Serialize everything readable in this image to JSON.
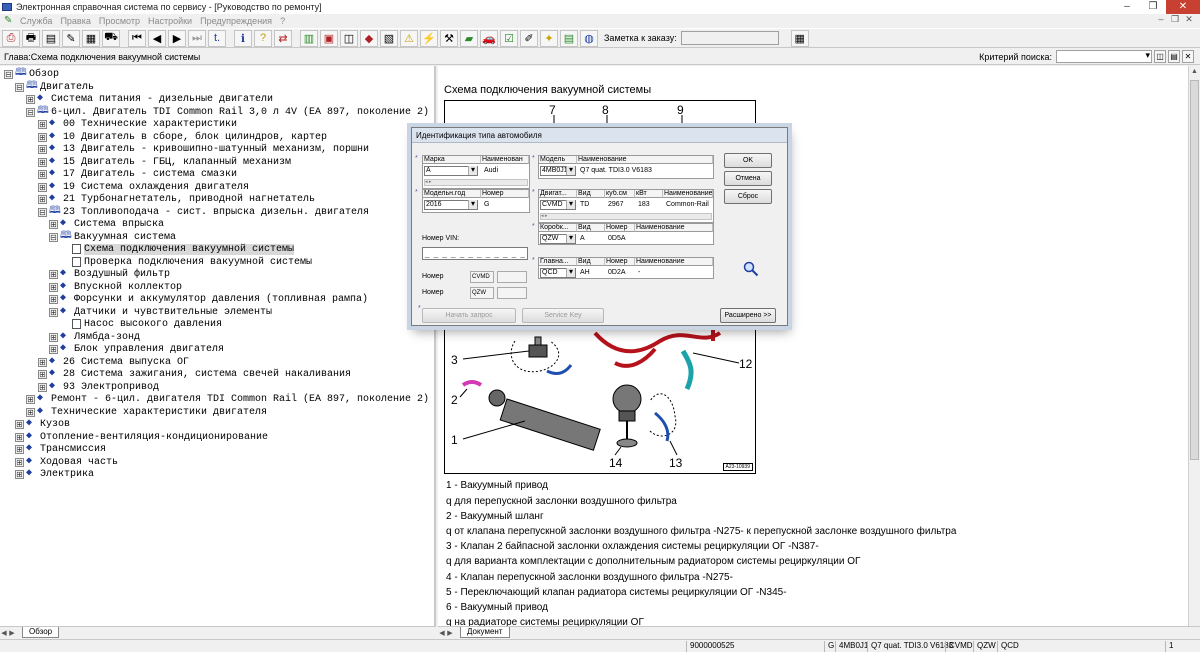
{
  "window": {
    "title": "Электронная справочная система по сервису - [Руководство по ремонту]",
    "controls": [
      "–",
      "❐",
      "✕"
    ]
  },
  "menu": {
    "items": [
      "Служба",
      "Правка",
      "Просмотр",
      "Настройки",
      "Предупреждения",
      "?"
    ],
    "right_controls": [
      "–",
      "❐",
      "✕"
    ]
  },
  "toolbar": {
    "order_note_label": "Заметка к заказу:",
    "order_note_value": ""
  },
  "chapter": {
    "label": "Глава:Схема подключения вакуумной системы",
    "search_criteria_label": "Критерий поиска:",
    "search_criteria_value": ""
  },
  "tree": [
    {
      "label": "Обзор",
      "expander": "⊟",
      "icon": "book-open-icon",
      "selected": false
    },
    {
      "label": "Двигатель",
      "expander": "⊟",
      "icon": "book-open-icon",
      "selected": false
    },
    {
      "label": "Система питания - дизельные двигатели",
      "expander": "⊞",
      "icon": "book-closed-icon",
      "selected": false
    },
    {
      "label": "6-цил. Двигатель TDI Common Rail 3,0 л 4V (EA 897, поколение 2)",
      "expander": "⊟",
      "icon": "book-open-icon",
      "selected": false
    },
    {
      "label": "00 Технические характеристики",
      "expander": "⊞",
      "icon": "book-closed-icon",
      "selected": false
    },
    {
      "label": "10 Двигатель в сборе, блок цилиндров, картер",
      "expander": "⊞",
      "icon": "book-closed-icon",
      "selected": false
    },
    {
      "label": "13 Двигатель - кривошипно-шатунный механизм, поршни",
      "expander": "⊞",
      "icon": "book-closed-icon",
      "selected": false
    },
    {
      "label": "15 Двигатель - ГБЦ, клапанный механизм",
      "expander": "⊞",
      "icon": "book-closed-icon",
      "selected": false
    },
    {
      "label": "17 Двигатель - система смазки",
      "expander": "⊞",
      "icon": "book-closed-icon",
      "selected": false
    },
    {
      "label": "19 Система охлаждения двигателя",
      "expander": "⊞",
      "icon": "book-closed-icon",
      "selected": false
    },
    {
      "label": "21 Турбонагнетатель, приводной нагнетатель",
      "expander": "⊞",
      "icon": "book-closed-icon",
      "selected": false
    },
    {
      "label": "23 Топливоподача - сист. впрыска дизельн. двигателя",
      "expander": "⊟",
      "icon": "book-open-icon",
      "selected": false
    },
    {
      "label": "Система впрыска",
      "expander": "⊞",
      "icon": "book-closed-icon",
      "selected": false
    },
    {
      "label": "Вакуумная система",
      "expander": "⊟",
      "icon": "book-open-icon",
      "selected": false
    },
    {
      "label": "Схема подключения вакуумной системы",
      "expander": "",
      "icon": "page-icon",
      "selected": true
    },
    {
      "label": "Проверка подключения вакуумной системы",
      "expander": "",
      "icon": "page-icon",
      "selected": false
    },
    {
      "label": "Воздушный фильтр",
      "expander": "⊞",
      "icon": "book-closed-icon",
      "selected": false
    },
    {
      "label": "Впускной коллектор",
      "expander": "⊞",
      "icon": "book-closed-icon",
      "selected": false
    },
    {
      "label": "Форсунки и аккумулятор давления (топливная рампа)",
      "expander": "⊞",
      "icon": "book-closed-icon",
      "selected": false
    },
    {
      "label": "Датчики и чувствительные элементы",
      "expander": "⊞",
      "icon": "book-closed-icon",
      "selected": false
    },
    {
      "label": "Насос высокого давления",
      "expander": "",
      "icon": "page-icon",
      "selected": false
    },
    {
      "label": "Лямбда-зонд",
      "expander": "⊞",
      "icon": "book-closed-icon",
      "selected": false
    },
    {
      "label": "Блок управления двигателя",
      "expander": "⊞",
      "icon": "book-closed-icon",
      "selected": false
    },
    {
      "label": "26 Система выпуска ОГ",
      "expander": "⊞",
      "icon": "book-closed-icon",
      "selected": false
    },
    {
      "label": "28 Система зажигания, система свечей накаливания",
      "expander": "⊞",
      "icon": "book-closed-icon",
      "selected": false
    },
    {
      "label": "93 Электропривод",
      "expander": "⊞",
      "icon": "book-closed-icon",
      "selected": false
    },
    {
      "label": "Ремонт - 6-цил. двигателя TDI Common Rail (EA 897, поколение 2)",
      "expander": "⊞",
      "icon": "book-closed-icon",
      "selected": false
    },
    {
      "label": "Технические характеристики двигателя",
      "expander": "⊞",
      "icon": "book-closed-icon",
      "selected": false
    },
    {
      "label": "Кузов",
      "expander": "⊞",
      "icon": "book-closed-icon",
      "selected": false
    },
    {
      "label": "Отопление-вентиляция-кондиционирование",
      "expander": "⊞",
      "icon": "book-closed-icon",
      "selected": false
    },
    {
      "label": "Трансмиссия",
      "expander": "⊞",
      "icon": "book-closed-icon",
      "selected": false
    },
    {
      "label": "Ходовая часть",
      "expander": "⊞",
      "icon": "book-closed-icon",
      "selected": false
    },
    {
      "label": "Электрика",
      "expander": "⊞",
      "icon": "book-closed-icon",
      "selected": false
    }
  ],
  "document": {
    "title": "Схема подключения вакуумной системы",
    "diagram": {
      "ref": "A23-10939",
      "callouts": [
        "7",
        "8",
        "9",
        "3",
        "2",
        "1",
        "14",
        "13",
        "12",
        "11"
      ]
    },
    "legend": [
      "1 -  Вакуумный привод",
      "q   для перепускной заслонки воздушного фильтра",
      "2 -  Вакуумный шланг",
      "q   от клапана перепускной заслонки воздушного фильтра -N275- к перепускной заслонке воздушного фильтра",
      "3 -  Клапан 2 байпасной заслонки охлаждения системы рециркуляции ОГ -N387-",
      "q   для варианта комплектации с дополнительным радиатором системы рециркуляции ОГ",
      "4 -  Клапан перепускной заслонки воздушного фильтра -N275-",
      "5 -  Переключающий клапан радиатора системы рециркуляции ОГ -N345-",
      "6 -  Вакуумный привод",
      "q   на радиаторе системы рециркуляции ОГ"
    ]
  },
  "tabs": {
    "left": "Обзор",
    "right": "Документ"
  },
  "dialog": {
    "title": "Идентификация типа автомобиля",
    "brand": {
      "head_code": "Марка",
      "head_name": "Наименован",
      "code": "A",
      "name": "Audi"
    },
    "model_year": {
      "head_code": "Модельн.год",
      "head_num": "Номер",
      "code": "2016",
      "num": "G"
    },
    "model": {
      "head_code": "Модель",
      "head_name": "Наименование",
      "code": "4MB0J1",
      "name": "Q7 quat. TDI3.0 V6183"
    },
    "engine": {
      "heads": [
        "Двигат...",
        "Вид",
        "куб.см",
        "кВт",
        "Наименование"
      ],
      "code": "CVMD",
      "values": [
        "TD",
        "2967",
        "183",
        "Common-Rail"
      ]
    },
    "gearbox": {
      "heads": [
        "Коробк...",
        "Вид",
        "Номер",
        "Наименование"
      ],
      "code": "QZW",
      "values": [
        "A",
        "0D5A",
        ""
      ]
    },
    "main_gear": {
      "heads": [
        "Главна...",
        "Вид",
        "Номер",
        "Наименование"
      ],
      "code": "QCD",
      "values": [
        "AH",
        "0D2A",
        "-"
      ]
    },
    "vin_label": "Номер VIN:",
    "vin_value": "_ _ _ _ _ _ _ _ _ _ _ _",
    "number_label_1": "Номер",
    "number_value_1": "CVMD",
    "number_label_2": "Номер",
    "number_value_2": "QZW",
    "buttons": {
      "ok": "OK",
      "cancel": "Отмена",
      "reset": "Сброс",
      "start_query": "Начать запрос",
      "service_key": "Service Key",
      "extended": "Расширено >>"
    }
  },
  "statusbar": {
    "order_number": "9000000525",
    "brand": "G",
    "model_code": "4MB0J1",
    "model_name": "Q7 quat. TDI3.0 V6183",
    "engine": "CVMD",
    "gearbox": "QZW",
    "main_gear": "QCD",
    "page": "1"
  },
  "colors": {
    "tree_icon": "#1f3ea0",
    "hose_red": "#b5121b",
    "hose_cyan": "#1aa3a8",
    "hose_blue": "#1e4fb0",
    "hose_magenta": "#d33ab5"
  }
}
